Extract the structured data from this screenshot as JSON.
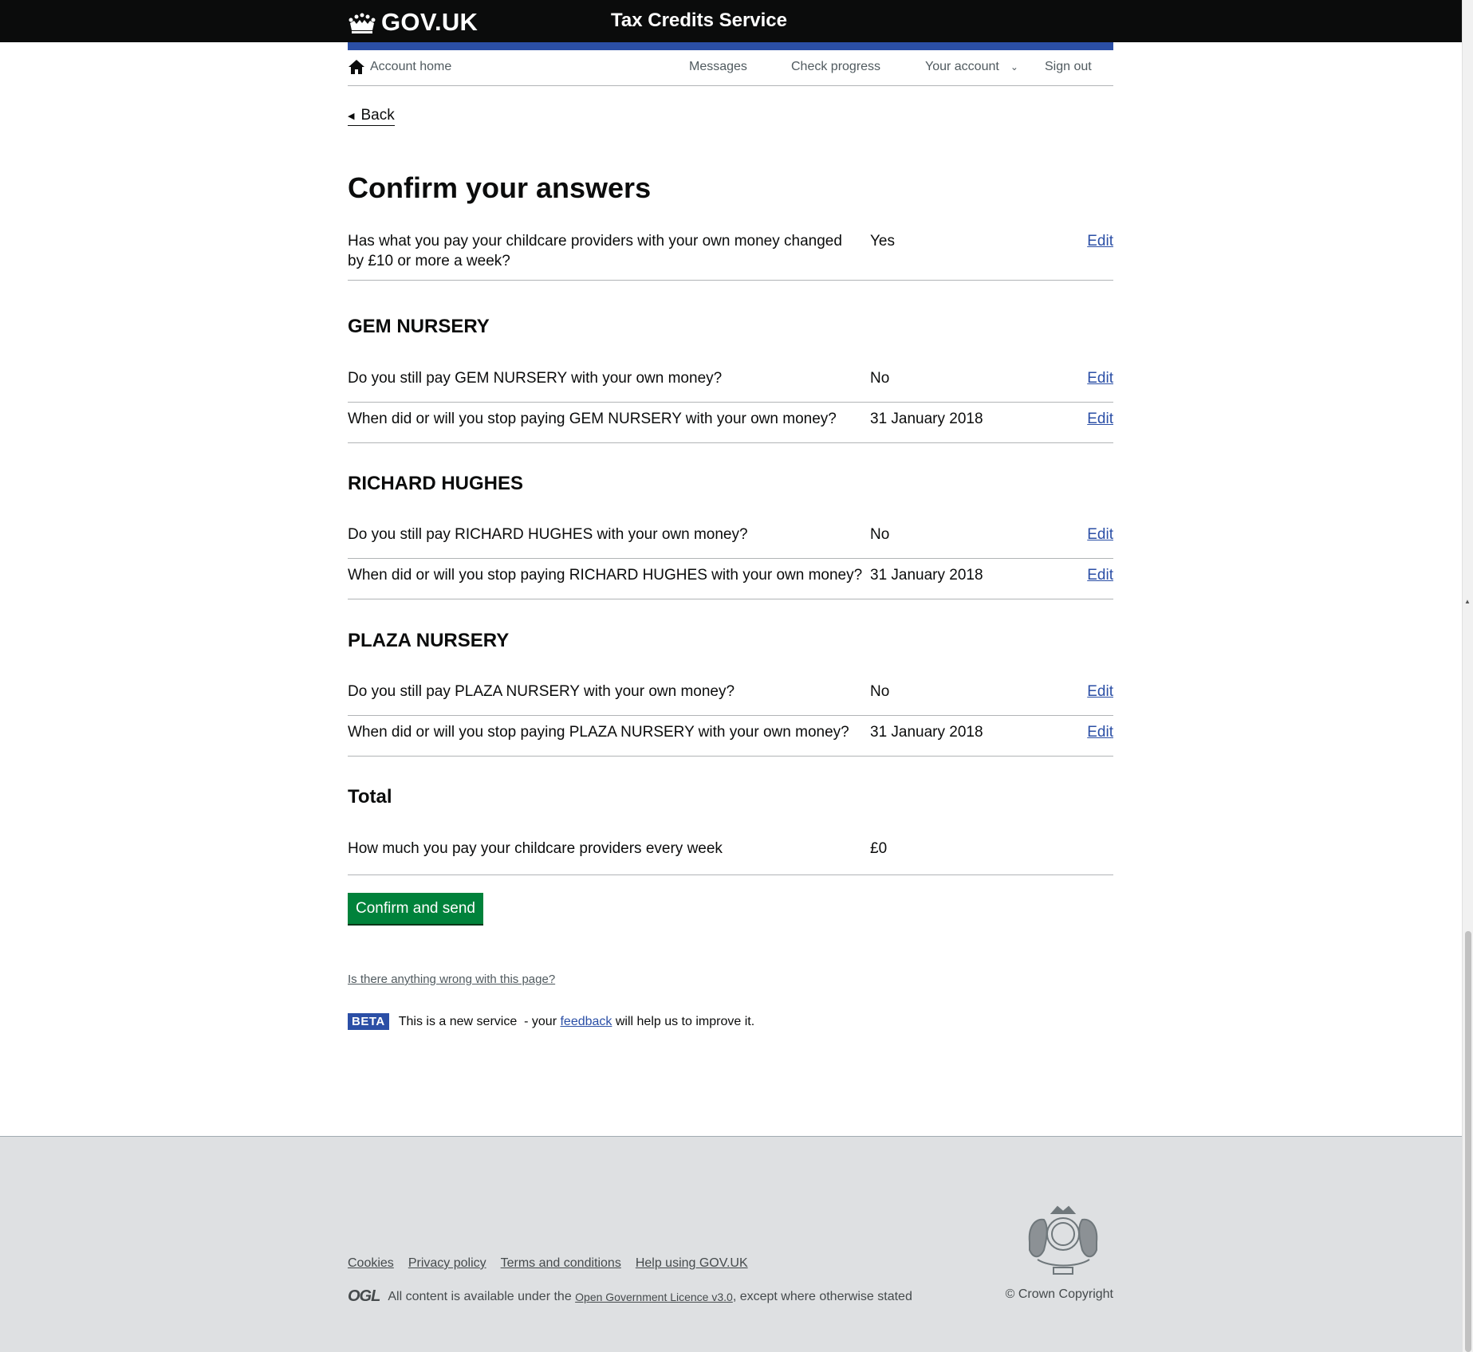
{
  "header": {
    "logo_text": "GOV.UK",
    "service_name": "Tax Credits Service",
    "bar_color": "#2b4fa6"
  },
  "nav": {
    "home": "Account home",
    "messages": "Messages",
    "check_progress": "Check progress",
    "your_account": "Your account",
    "sign_out": "Sign out"
  },
  "main": {
    "back": "Back",
    "title": "Confirm your answers",
    "intro_row": {
      "question": "Has what you pay your childcare providers with your own money changed by £10 or more a week?",
      "answer": "Yes",
      "edit": "Edit"
    },
    "sections": [
      {
        "heading": "GEM NURSERY",
        "rows": [
          {
            "question": "Do you still pay GEM NURSERY with your own money?",
            "answer": "No",
            "edit": "Edit"
          },
          {
            "question": "When did or will you stop paying GEM NURSERY with your own money?",
            "answer": "31 January 2018",
            "edit": "Edit"
          }
        ]
      },
      {
        "heading": "RICHARD HUGHES",
        "rows": [
          {
            "question": "Do you still pay RICHARD HUGHES with your own money?",
            "answer": "No",
            "edit": "Edit"
          },
          {
            "question": "When did or will you stop paying RICHARD HUGHES with your own money?",
            "answer": "31 January 2018",
            "edit": "Edit"
          }
        ]
      },
      {
        "heading": "PLAZA NURSERY",
        "rows": [
          {
            "question": "Do you still pay PLAZA NURSERY with your own money?",
            "answer": "No",
            "edit": "Edit"
          },
          {
            "question": "When did or will you stop paying PLAZA NURSERY with your own money?",
            "answer": "31 January 2018",
            "edit": "Edit"
          }
        ]
      },
      {
        "heading": "Total",
        "rows": [
          {
            "question": "How much you pay your childcare providers every week",
            "answer": "£0",
            "edit": ""
          }
        ]
      }
    ],
    "confirm_button": "Confirm and send",
    "wrong_link": "Is there anything wrong with this page?",
    "beta": {
      "tag": "BETA",
      "text_before": "This is a new service  - your ",
      "link": "feedback",
      "text_after": " will help us to improve it."
    }
  },
  "footer": {
    "links": [
      "Cookies",
      "Privacy policy",
      "Terms and conditions",
      "Help using GOV.UK"
    ],
    "ogl": "OGL",
    "licence_before": "All content is available under the ",
    "licence_link": "Open Government Licence v3.0",
    "licence_after": ", except where otherwise stated",
    "copyright": "© Crown Copyright"
  }
}
